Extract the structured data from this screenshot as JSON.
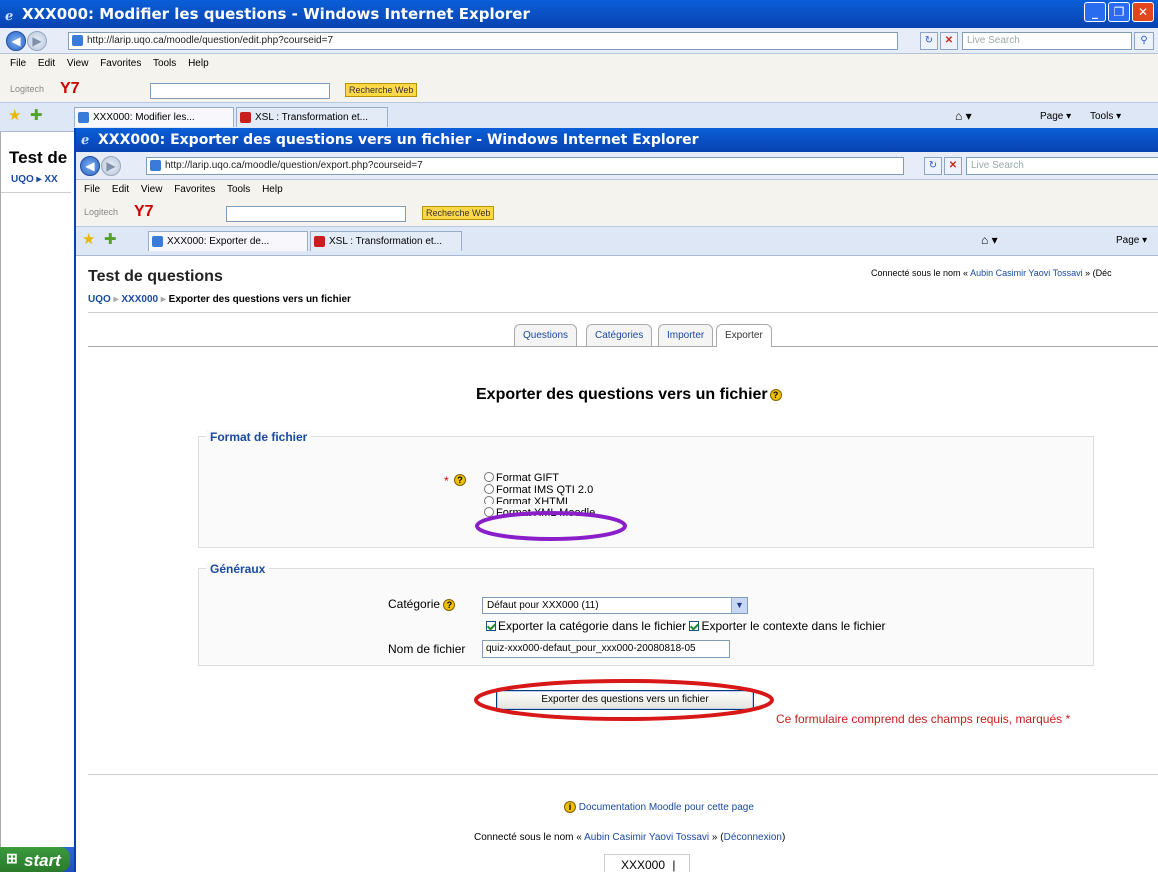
{
  "outer_window": {
    "title": "XXX000: Modifier les questions - Windows Internet Explorer",
    "url": "http://larip.uqo.ca/moodle/question/edit.php?courseid=7",
    "search_placeholder": "Live Search",
    "menu": [
      "File",
      "Edit",
      "View",
      "Favorites",
      "Tools",
      "Help"
    ],
    "toolbar": {
      "logitech": "Logitech",
      "search_button": "Recherche Web"
    },
    "tabs": [
      "XXX000: Modifier les...",
      "XSL : Transformation et..."
    ],
    "right_tools": {
      "page": "Page",
      "tools": "Tools"
    },
    "page_title_partial": "Test de",
    "breadcrumb_partial": "UQO ▸ XX"
  },
  "inner_window": {
    "title": "XXX000: Exporter des questions vers un fichier - Windows Internet Explorer",
    "url": "http://larip.uqo.ca/moodle/question/export.php?courseid=7",
    "search_placeholder": "Live Search",
    "menu": [
      "File",
      "Edit",
      "View",
      "Favorites",
      "Tools",
      "Help"
    ],
    "toolbar": {
      "logitech": "Logitech",
      "search_button": "Recherche Web"
    },
    "tabs": [
      "XXX000: Exporter de...",
      "XSL : Transformation et..."
    ],
    "right_tools": {
      "page": "Page"
    }
  },
  "page": {
    "site_title": "Test de questions",
    "login_text_prefix": "Connecté sous le nom « ",
    "login_user": "Aubin Casimir Yaovi Tossavi",
    "login_text_suffix": " » (Déc",
    "breadcrumb": {
      "home": "UQO",
      "course": "XXX000",
      "current": "Exporter des questions vers un fichier"
    },
    "tabs": [
      "Questions",
      "Catégories",
      "Importer",
      "Exporter"
    ],
    "selected_tab": "Exporter",
    "heading": "Exporter des questions vers un fichier",
    "format_section": {
      "legend": "Format de fichier",
      "required_marker": "*",
      "options": [
        "Format GIFT",
        "Format IMS QTI 2.0",
        "Format XHTML",
        "Format XML Moodle"
      ]
    },
    "general_section": {
      "legend": "Généraux",
      "category_label": "Catégorie",
      "category_value": "Défaut pour XXX000 (11)",
      "export_category_label": "Exporter la catégorie dans le fichier",
      "export_context_label": "Exporter le contexte dans le fichier",
      "filename_label": "Nom de fichier",
      "filename_value": "quiz-xxx000-defaut_pour_xxx000-20080818-05"
    },
    "submit_label": "Exporter des questions vers un fichier",
    "required_note": "Ce formulaire comprend des champs requis, marqués *",
    "footer": {
      "doc_link": "Documentation Moodle pour cette page",
      "login_prefix": "Connecté sous le nom « ",
      "login_user": "Aubin Casimir Yaovi Tossavi",
      "login_mid": " » (",
      "logout": "Déconnexion",
      "login_end": ")",
      "course_short": "XXX000"
    }
  },
  "taskbar": {
    "start": "start"
  },
  "colors": {
    "annotation_red": "#d81818",
    "annotation_purple": "#8a1ec8",
    "link": "#1a4aa0"
  }
}
